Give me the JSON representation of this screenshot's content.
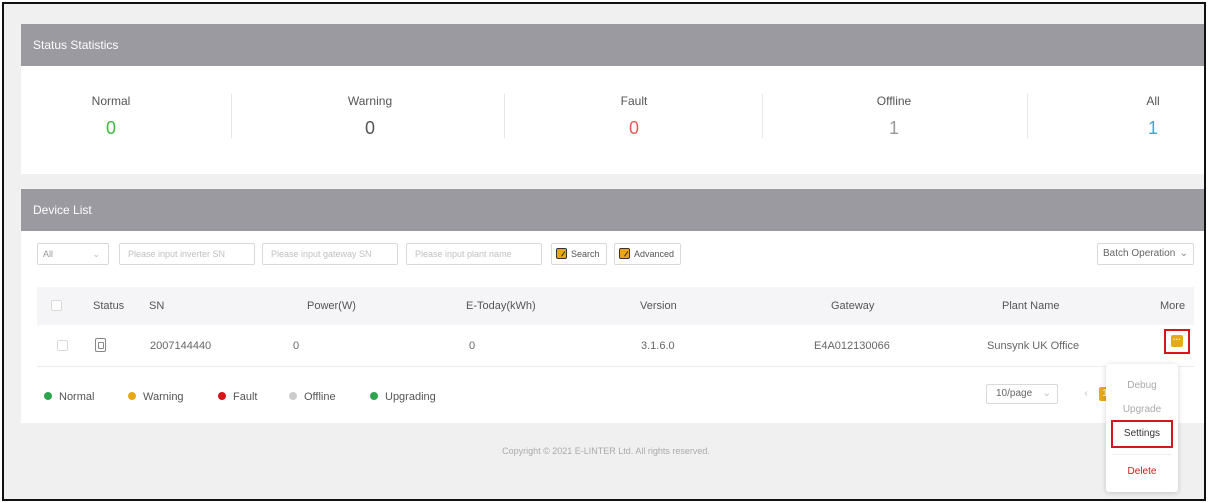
{
  "status_statistics": {
    "title": "Status Statistics",
    "items": [
      {
        "label": "Normal",
        "value": "0",
        "color": "#3dba3d"
      },
      {
        "label": "Warning",
        "value": "0",
        "color": "#555555"
      },
      {
        "label": "Fault",
        "value": "0",
        "color": "#e85a5a"
      },
      {
        "label": "Offline",
        "value": "1",
        "color": "#999999"
      },
      {
        "label": "All",
        "value": "1",
        "color": "#3ba8d8"
      }
    ]
  },
  "device_list": {
    "title": "Device List",
    "filter": {
      "type_select": "All",
      "inverter_sn_placeholder": "Please input inverter SN",
      "gateway_sn_placeholder": "Please input gateway SN",
      "plant_name_placeholder": "Please input plant name",
      "search_label": "Search",
      "advanced_label": "Advanced",
      "batch_label": "Batch Operation"
    },
    "columns": [
      "Status",
      "SN",
      "Power(W)",
      "E-Today(kWh)",
      "Version",
      "Gateway",
      "Plant Name",
      "More"
    ],
    "rows": [
      {
        "sn": "2007144440",
        "power": "0",
        "etoday": "0",
        "version": "3.1.6.0",
        "gateway": "E4A012130066",
        "plant": "Sunsynk UK Office"
      }
    ],
    "legend": [
      {
        "label": "Normal",
        "color": "#2ea44f"
      },
      {
        "label": "Warning",
        "color": "#e8a817"
      },
      {
        "label": "Fault",
        "color": "#d6161b"
      },
      {
        "label": "Offline",
        "color": "#cccccc"
      },
      {
        "label": "Upgrading",
        "color": "#2ea44f"
      }
    ],
    "pager": {
      "page_size": "10/page",
      "current_page": "1"
    }
  },
  "more_menu": {
    "items": [
      "Debug",
      "Upgrade",
      "Settings",
      "Delete"
    ]
  },
  "footer": "Copyright © 2021 E-LINTER Ltd. All rights reserved."
}
